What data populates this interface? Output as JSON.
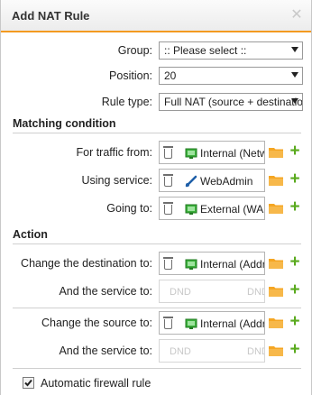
{
  "dialog": {
    "title": "Add NAT Rule",
    "close_glyph": "✕"
  },
  "form": {
    "group": {
      "label": "Group:",
      "value": ":: Please select ::"
    },
    "position": {
      "label": "Position:",
      "value": "20"
    },
    "rule_type": {
      "label": "Rule type:",
      "value": "Full NAT (source + destination)"
    }
  },
  "matching": {
    "heading": "Matching condition",
    "traffic_from": {
      "label": "For traffic from:",
      "value": "Internal (Network)",
      "icon": "network-icon"
    },
    "using_service": {
      "label": "Using service:",
      "value": "WebAdmin",
      "icon": "service-icon"
    },
    "going_to": {
      "label": "Going to:",
      "value": "External (WAN)",
      "icon": "network-icon"
    }
  },
  "action": {
    "heading": "Action",
    "change_destination": {
      "label": "Change the destination to:",
      "value": "Internal (Address)",
      "icon": "network-icon"
    },
    "dest_service": {
      "label": "And the service to:",
      "placeholder": "DND"
    },
    "change_source": {
      "label": "Change the source to:",
      "value": "Internal (Address)",
      "icon": "network-icon"
    },
    "source_service": {
      "label": "And the service to:",
      "placeholder": "DND"
    }
  },
  "options": {
    "auto_firewall": {
      "label": "Automatic firewall rule",
      "checked": true
    }
  },
  "colors": {
    "accent_orange": "#f39a20",
    "add_green": "#5aaa1e",
    "network_green": "#3bb03b",
    "service_blue": "#1f5fa8"
  }
}
